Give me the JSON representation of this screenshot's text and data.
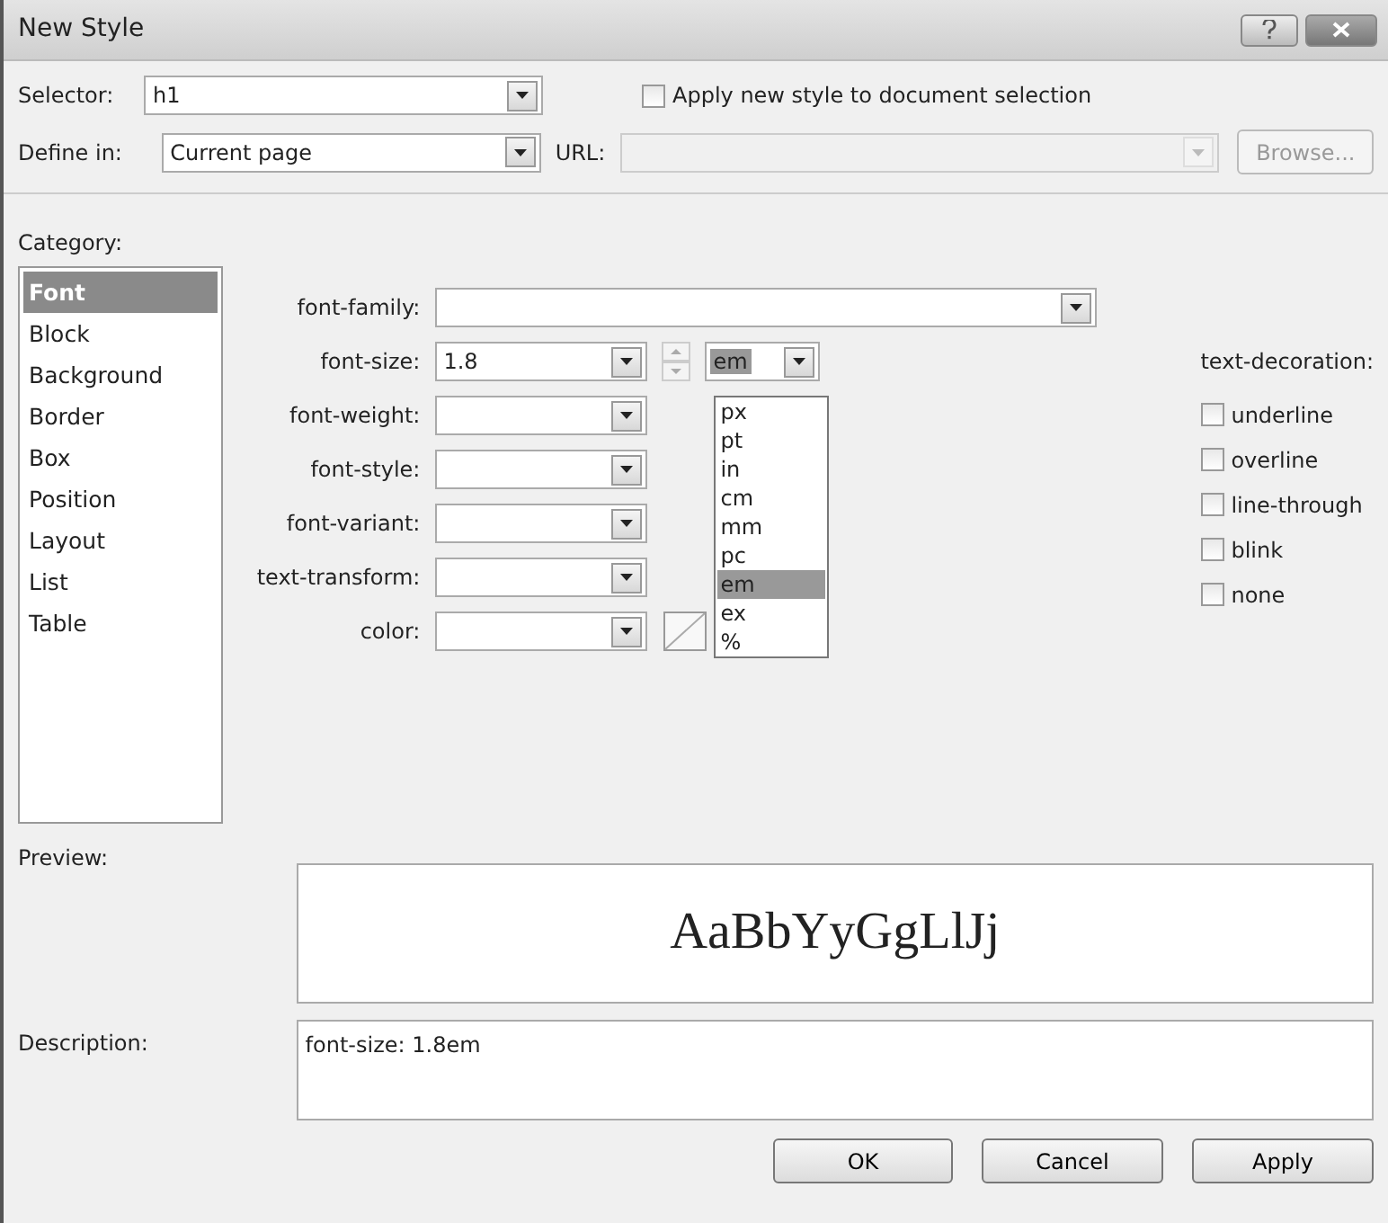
{
  "window": {
    "title": "New Style"
  },
  "selector": {
    "label": "Selector:",
    "value": "h1"
  },
  "apply_to_selection": {
    "label": "Apply new style to document selection",
    "checked": false
  },
  "define_in": {
    "label": "Define in:",
    "value": "Current page"
  },
  "url": {
    "label": "URL:",
    "disabled": true
  },
  "browse_button": {
    "label": "Browse...",
    "disabled": true
  },
  "category": {
    "label": "Category:",
    "items": [
      {
        "label": "Font",
        "selected": true
      },
      {
        "label": "Block",
        "selected": false
      },
      {
        "label": "Background",
        "selected": false
      },
      {
        "label": "Border",
        "selected": false
      },
      {
        "label": "Box",
        "selected": false
      },
      {
        "label": "Position",
        "selected": false
      },
      {
        "label": "Layout",
        "selected": false
      },
      {
        "label": "List",
        "selected": false
      },
      {
        "label": "Table",
        "selected": false
      }
    ]
  },
  "properties": [
    {
      "label": "font-family:",
      "kind": "wide"
    },
    {
      "label": "font-size:",
      "kind": "size",
      "value": "1.8",
      "unit": "em"
    },
    {
      "label": "font-weight:",
      "kind": "combo"
    },
    {
      "label": "font-style:",
      "kind": "combo"
    },
    {
      "label": "font-variant:",
      "kind": "combo"
    },
    {
      "label": "text-transform:",
      "kind": "combo"
    },
    {
      "label": "color:",
      "kind": "color"
    }
  ],
  "unit_options": [
    {
      "label": "px",
      "selected": false
    },
    {
      "label": "pt",
      "selected": false
    },
    {
      "label": "in",
      "selected": false
    },
    {
      "label": "cm",
      "selected": false
    },
    {
      "label": "mm",
      "selected": false
    },
    {
      "label": "pc",
      "selected": false
    },
    {
      "label": "em",
      "selected": true
    },
    {
      "label": "ex",
      "selected": false
    },
    {
      "label": "%",
      "selected": false
    }
  ],
  "text_decoration": {
    "label": "text-decoration:",
    "options": [
      {
        "label": "underline",
        "checked": false
      },
      {
        "label": "overline",
        "checked": false
      },
      {
        "label": "line-through",
        "checked": false
      },
      {
        "label": "blink",
        "checked": false
      },
      {
        "label": "none",
        "checked": false
      }
    ]
  },
  "preview": {
    "label": "Preview:",
    "sample": "AaBbYyGgLlJj"
  },
  "description": {
    "label": "Description:",
    "value": "font-size: 1.8em"
  },
  "buttons": [
    {
      "label": "OK"
    },
    {
      "label": "Cancel"
    },
    {
      "label": "Apply"
    }
  ]
}
